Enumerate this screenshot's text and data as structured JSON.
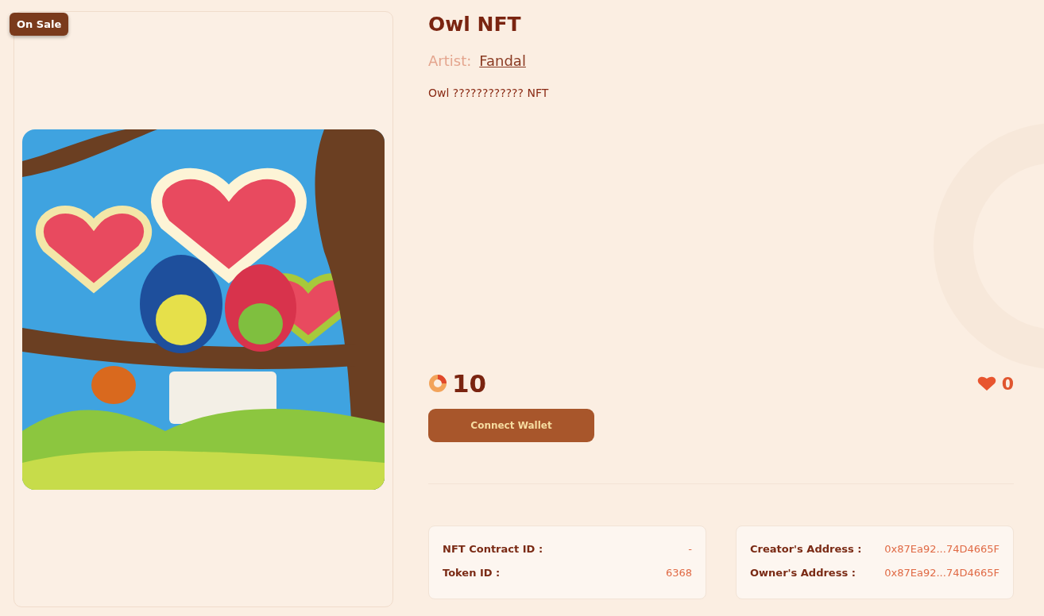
{
  "badge": "On Sale",
  "title": "Owl NFT",
  "artist": {
    "label": "Artist:",
    "name": "Fandal"
  },
  "description": "Owl ???????????? NFT",
  "price": {
    "value": "10"
  },
  "likes": {
    "count": "0"
  },
  "connect_button": "Connect Wallet",
  "info_cards": [
    {
      "rows": [
        {
          "label": "NFT Contract ID :",
          "value": "-"
        },
        {
          "label": "Token ID :",
          "value": "6368"
        }
      ]
    },
    {
      "rows": [
        {
          "label": "Creator's Address :",
          "value": "0x87Ea92...74D4665F"
        },
        {
          "label": "Owner's Address :",
          "value": "0x87Ea92...74D4665F"
        }
      ]
    }
  ]
}
